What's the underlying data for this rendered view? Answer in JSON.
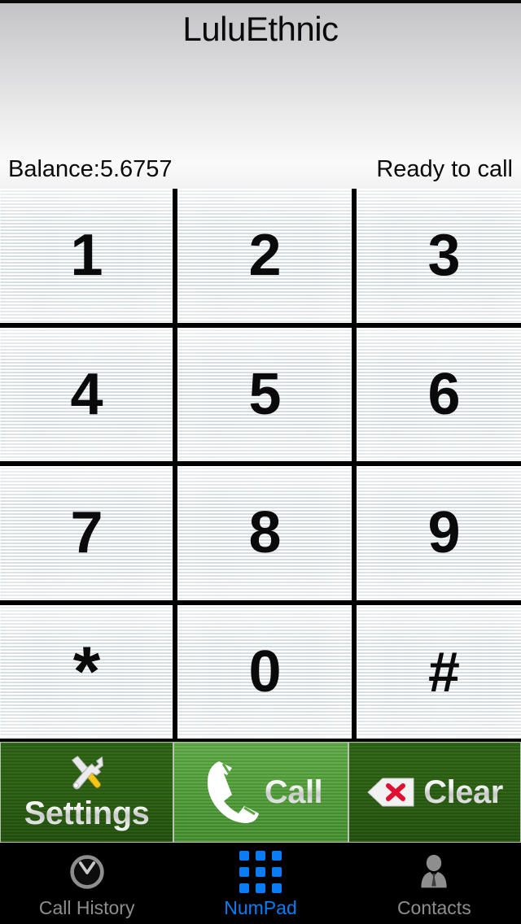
{
  "header": {
    "title": "LuluEthnic",
    "balance": "Balance:5.6757",
    "status": "Ready to call"
  },
  "keypad": {
    "keys": [
      {
        "label": "1",
        "name": "key-1"
      },
      {
        "label": "2",
        "name": "key-2"
      },
      {
        "label": "3",
        "name": "key-3"
      },
      {
        "label": "4",
        "name": "key-4"
      },
      {
        "label": "5",
        "name": "key-5"
      },
      {
        "label": "6",
        "name": "key-6"
      },
      {
        "label": "7",
        "name": "key-7"
      },
      {
        "label": "8",
        "name": "key-8"
      },
      {
        "label": "9",
        "name": "key-9"
      },
      {
        "label": "*",
        "name": "key-star"
      },
      {
        "label": "0",
        "name": "key-0"
      },
      {
        "label": "#",
        "name": "key-hash"
      }
    ]
  },
  "actions": {
    "settings_label": "Settings",
    "settings_icon": "wrench-screwdriver-icon",
    "call_label": "Call",
    "call_icon": "phone-handset-icon",
    "clear_label": "Clear",
    "clear_icon": "backspace-delete-icon"
  },
  "tabs": [
    {
      "label": "Call History",
      "icon": "clock-icon",
      "active": false
    },
    {
      "label": "NumPad",
      "icon": "keypad-grid-icon",
      "active": true
    },
    {
      "label": "Contacts",
      "icon": "person-icon",
      "active": false
    }
  ],
  "colors": {
    "accent_blue": "#0a7cf5",
    "call_green": "#4d9a35",
    "dark_green": "#2a5e11",
    "tab_inactive": "#8e8e8e",
    "clear_x_red": "#e01030"
  }
}
